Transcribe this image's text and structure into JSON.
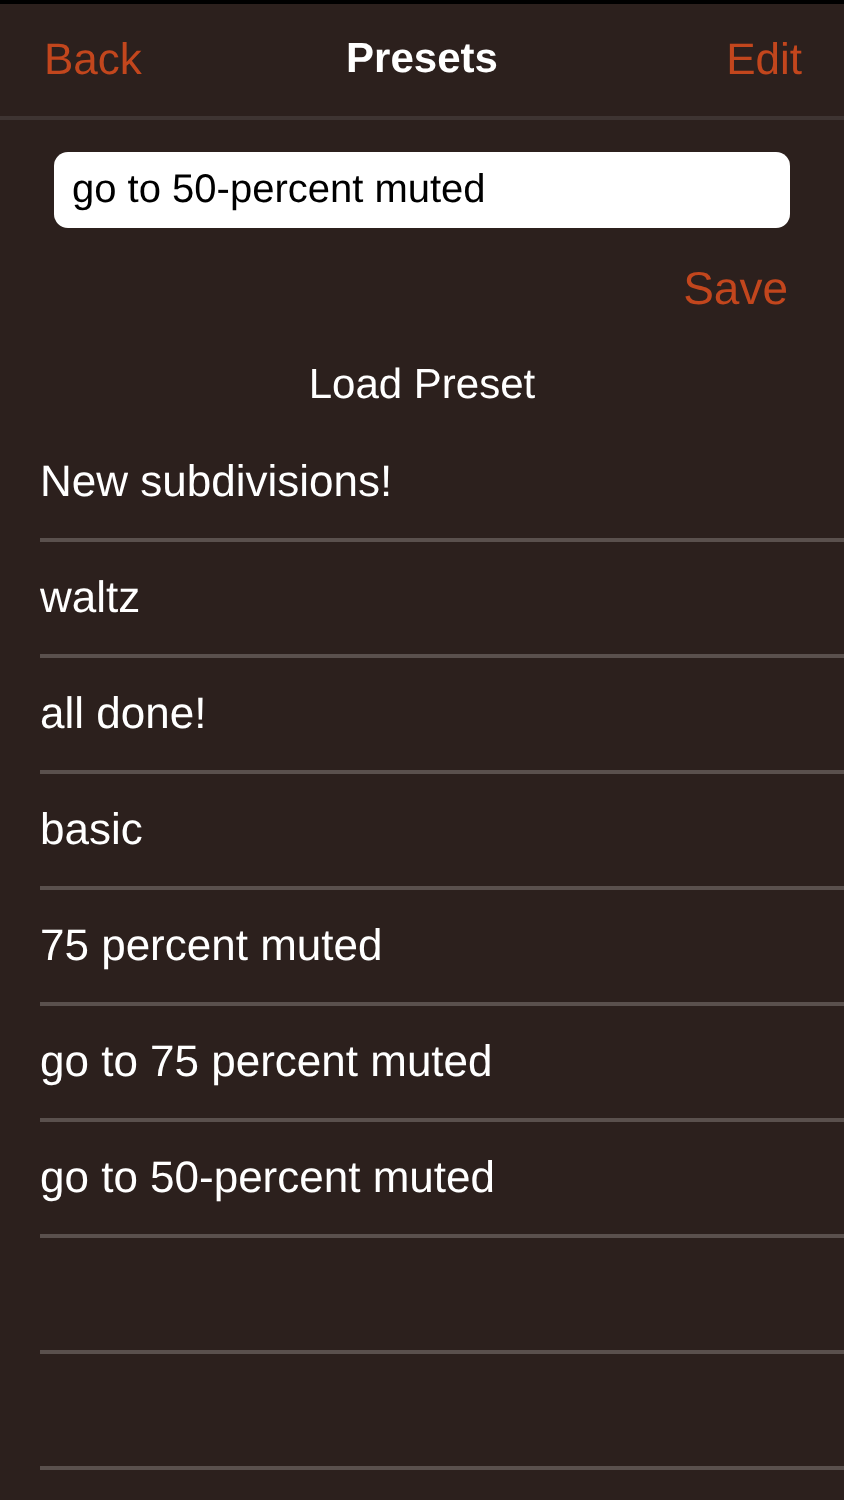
{
  "nav_bar": {
    "back": "Back",
    "title": "Presets",
    "edit": "Edit"
  },
  "name_field": {
    "value": "go to 50-percent muted"
  },
  "save": "Save",
  "list_header": "Load Preset",
  "presets": [
    {
      "name": "New subdivisions!"
    },
    {
      "name": "waltz"
    },
    {
      "name": "all done!"
    },
    {
      "name": "basic"
    },
    {
      "name": "75 percent muted"
    },
    {
      "name": "go to 75 percent muted"
    },
    {
      "name": "go to 50-percent muted"
    }
  ]
}
